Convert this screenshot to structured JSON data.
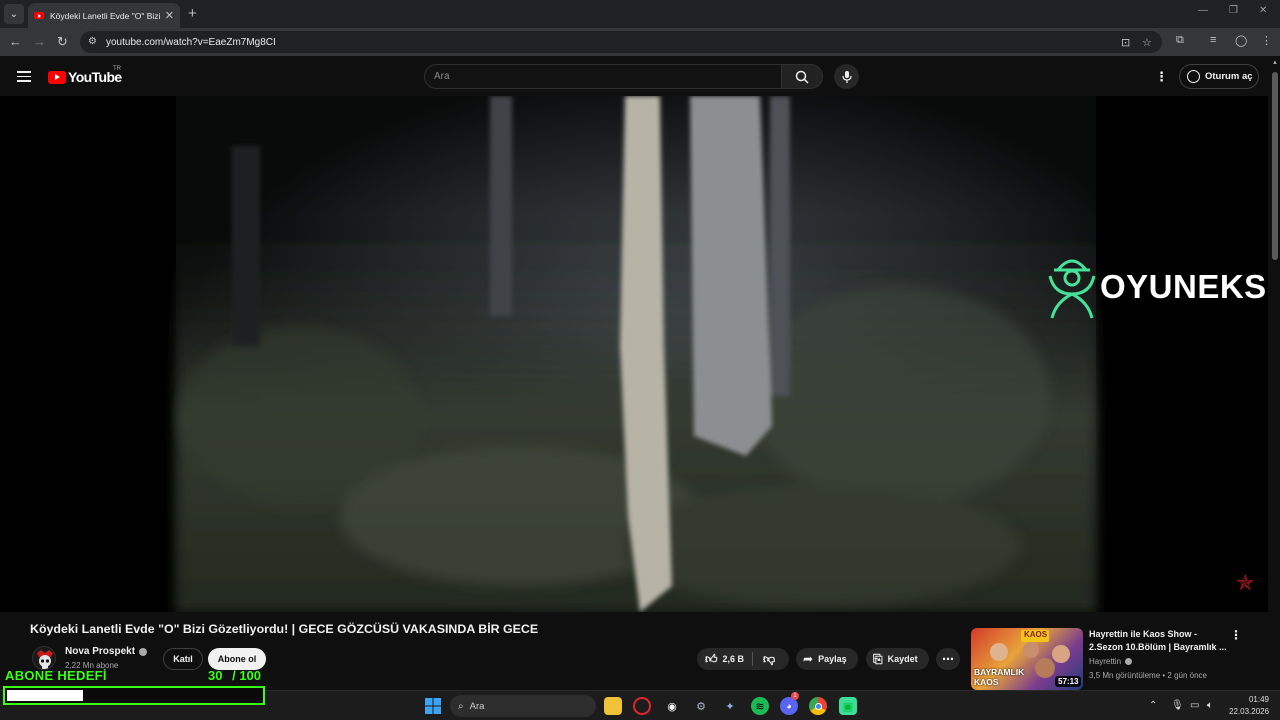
{
  "browser": {
    "tab_title": "Köydeki Lanetli Evde \"O\" Bizi Gözetliyordu! | GECE GÖZCÜSÜ VAKASINDA BİR GECE",
    "url": "youtube.com/watch?v=EaeZm7Mg8CI"
  },
  "youtube": {
    "logo_text": "YouTube",
    "region": "TR",
    "search_placeholder": "Ara",
    "signin_label": "Oturum aç"
  },
  "video": {
    "watermark": "OYUNEKS",
    "title": "Köydeki Lanetli Evde \"O\" Bizi Gözetliyordu! | GECE GÖZCÜSÜ VAKASINDA BİR GECE",
    "channel": "Nova Prospekt",
    "subscribers": "2,22 Mn abone",
    "join_label": "Katıl",
    "subscribe_label": "Abone ol",
    "likes": "2,6 B",
    "share_label": "Paylaş",
    "save_label": "Kaydet"
  },
  "suggested": {
    "title": "Hayrettin ile Kaos Show - 2.Sezon 10.Bölüm | Bayramlık ...",
    "channel": "Hayrettin",
    "meta": "3,5 Mn görüntüleme • 2 gün önce",
    "duration": "57:13",
    "thumb_text_line1": "BAYRAMLIK",
    "thumb_text_line2": "KAOS",
    "thumb_badge": "KAOS"
  },
  "overlay": {
    "goal_label": "ABONE HEDEFİ",
    "goal_current": "30",
    "goal_total": "/ 100",
    "goal_progress": 0.3
  },
  "taskbar": {
    "search_label": "Ara",
    "time": "01:49",
    "date": "22.03.2026",
    "discord_badge": "1"
  },
  "colors": {
    "accent_green": "#39ff14",
    "youtube_red": "#ff0000",
    "background": "#0f0f0f"
  }
}
